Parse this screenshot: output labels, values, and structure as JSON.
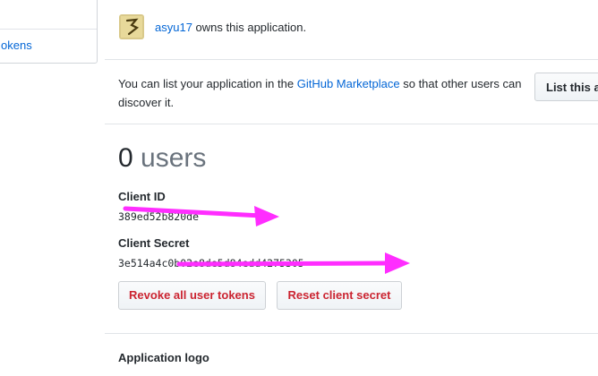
{
  "sidebar": {
    "partial_item_label": "okens"
  },
  "owner": {
    "username": "asyu17",
    "text": " owns this application."
  },
  "marketplace": {
    "text_before": "You can list your application in the ",
    "link": "GitHub Marketplace",
    "text_after": " so that other users can discover it.",
    "button_label": "List this a"
  },
  "users": {
    "count": "0",
    "label": " users"
  },
  "credentials": {
    "client_id_label": "Client ID",
    "client_id_value": "389ed52b820de",
    "client_secret_label": "Client Secret",
    "client_secret_value": "3e514a4c0b02e8de5d84edd4275305"
  },
  "actions": {
    "revoke_label": "Revoke all user tokens",
    "reset_label": "Reset client secret"
  },
  "logo_section": {
    "title": "Application logo"
  },
  "colors": {
    "link": "#0366d6",
    "danger": "#cb2431",
    "annotation": "#ff2dff"
  }
}
